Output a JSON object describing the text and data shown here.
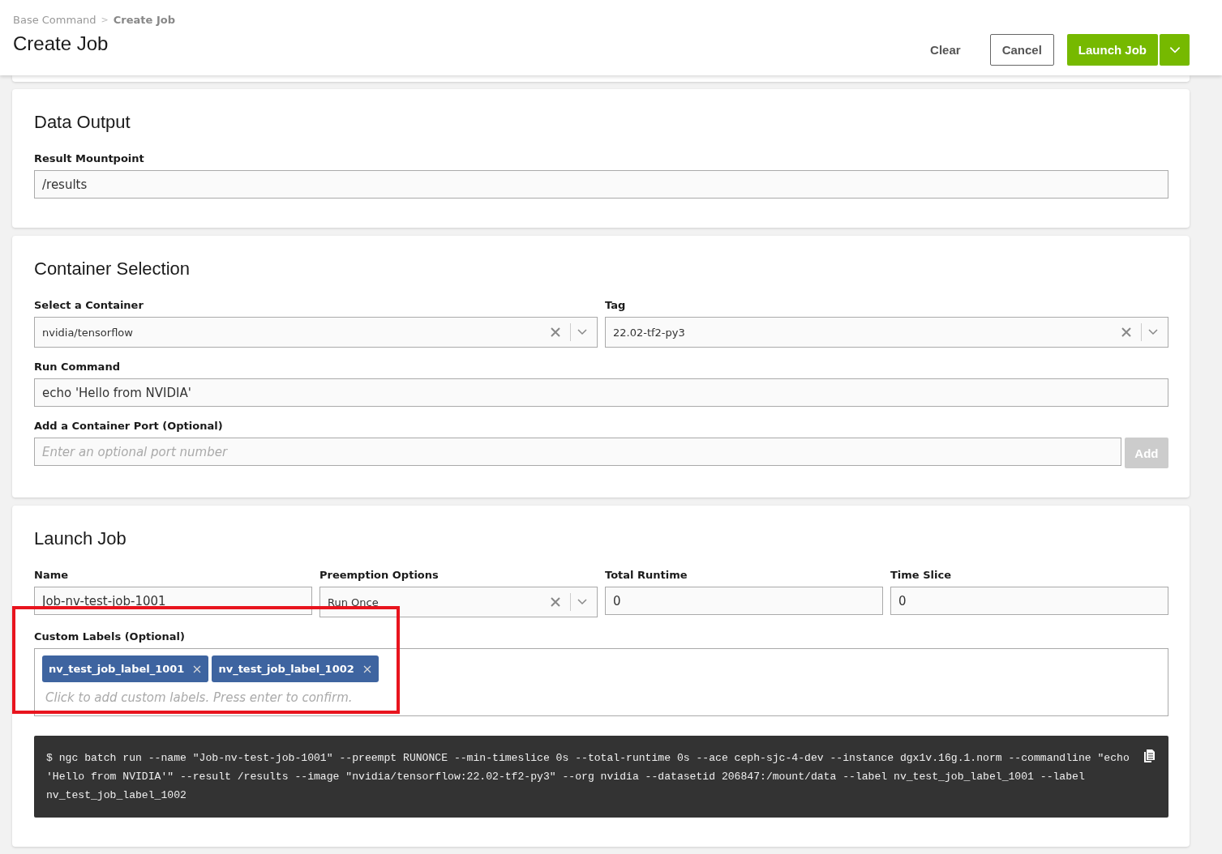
{
  "breadcrumb_separator": ">",
  "breadcrumb": [
    {
      "label": "Base Command",
      "current": false
    },
    {
      "label": "Create Job",
      "current": true
    }
  ],
  "page_title": "Create Job",
  "actions": [
    {
      "kind": "text",
      "label": "Clear"
    },
    {
      "kind": "outline",
      "label": "Cancel"
    },
    {
      "kind": "primary",
      "label": "Launch Job"
    },
    {
      "kind": "dropdown"
    }
  ],
  "sections": [
    {
      "title": "Data Output",
      "rows": [
        [
          {
            "kind": "input",
            "label": "Result Mountpoint",
            "value": "/results"
          }
        ]
      ]
    },
    {
      "title": "Container Selection",
      "rows": [
        [
          {
            "kind": "select",
            "label": "Select a Container",
            "value": "nvidia/tensorflow"
          },
          {
            "kind": "select",
            "label": "Tag",
            "value": "22.02-tf2-py3"
          }
        ],
        [
          {
            "kind": "input",
            "label": "Run Command",
            "value": "echo 'Hello from NVIDIA'"
          }
        ],
        [
          {
            "kind": "input_button",
            "label": "Add a Container Port (Optional)",
            "placeholder": "Enter an optional port number",
            "button": "Add",
            "disabled": true
          }
        ]
      ]
    },
    {
      "title": "Launch Job",
      "rows": [
        [
          {
            "kind": "input",
            "label": "Name",
            "value": "Job-nv-test-job-1001"
          },
          {
            "kind": "select",
            "label": "Preemption Options",
            "value": "Run Once"
          },
          {
            "kind": "input",
            "label": "Total Runtime",
            "value": "0"
          },
          {
            "kind": "input",
            "label": "Time Slice",
            "value": "0"
          }
        ],
        [
          {
            "kind": "tags",
            "label": "Custom Labels (Optional)",
            "tags": [
              "nv_test_job_label_1001",
              "nv_test_job_label_1002"
            ],
            "placeholder": "Click to add custom labels. Press enter to confirm.",
            "highlighted": true
          }
        ],
        [
          {
            "kind": "command",
            "text": "$ ngc batch run --name \"Job-nv-test-job-1001\" --preempt RUNONCE --min-timeslice 0s --total-runtime 0s --ace ceph-sjc-4-dev --instance dgx1v.16g.1.norm --commandline \"echo 'Hello from NVIDIA'\" --result /results --image \"nvidia/tensorflow:22.02-tf2-py3\" --org nvidia --datasetid 206847:/mount/data --label nv_test_job_label_1001 --label nv_test_job_label_1002"
          }
        ]
      ]
    }
  ]
}
